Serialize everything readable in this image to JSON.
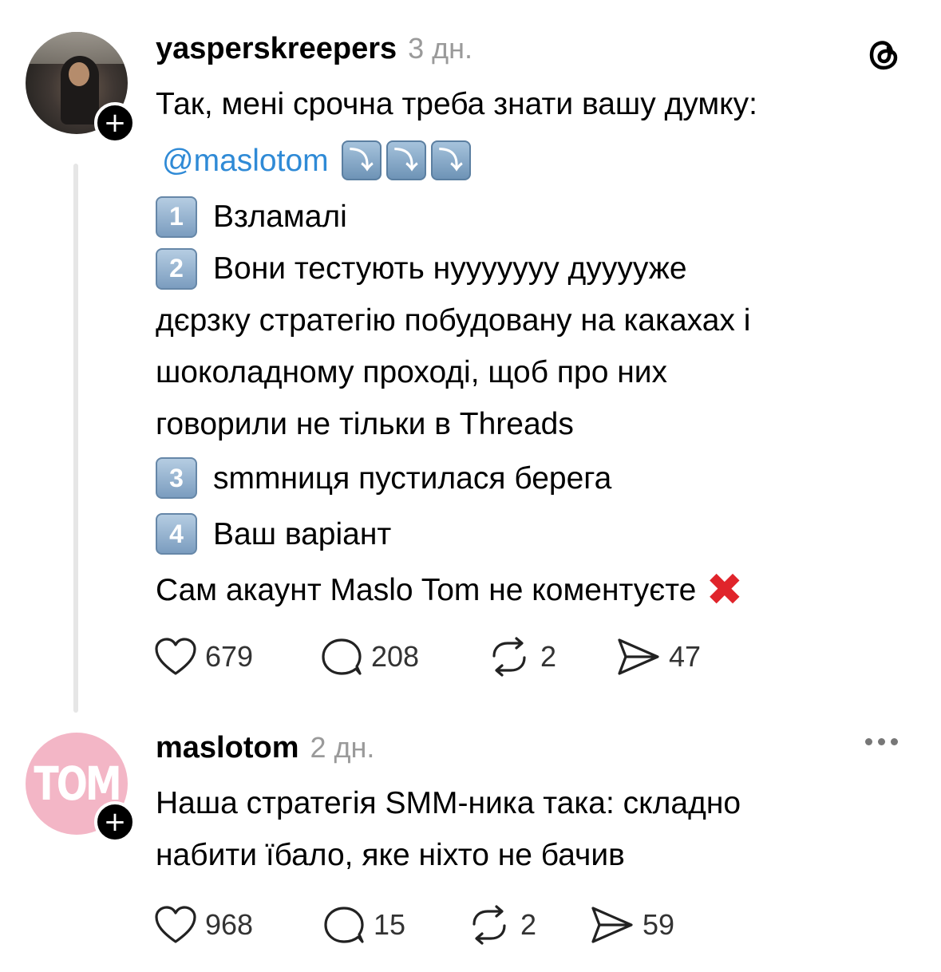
{
  "posts": [
    {
      "username": "yasperskreepers",
      "time": "3 дн.",
      "lines": {
        "intro": "Так, мені срочна треба знати вашу думку:",
        "mention": "@maslotom",
        "arrow_icons": [
          "⤵",
          "⤵",
          "⤵"
        ],
        "option1_num": "1",
        "option1": "Взламалі",
        "option2_num": "2",
        "option2_a": "Вони тестують нууууууу дуууу​же",
        "option2_b": "дєрзку стратегію побудовану на какахах і",
        "option2_c": "шоколадному проході, щоб про них",
        "option2_d": "говорили не тільки в Threads",
        "option3_num": "3",
        "option3": "smmниця пустилася берега",
        "option4_num": "4",
        "option4": "Ваш варіант",
        "closing": "Сам акаунт Maslo Tom не коментуєте",
        "closing_icon": "✖"
      },
      "stats": {
        "likes": "679",
        "replies": "208",
        "reposts": "2",
        "shares": "47"
      }
    },
    {
      "username": "maslotom",
      "time": "2 дн.",
      "avatar_text": "TOM",
      "lines": {
        "l1": "Наша стратегія SMM-ника така: складно",
        "l2": "набити їбало, яке ніхто не бачив"
      },
      "stats": {
        "likes": "968",
        "replies": "15",
        "reposts": "2",
        "shares": "59"
      }
    }
  ],
  "icons": {
    "app": "threads-logo-icon",
    "follow": "+",
    "like": "heart-icon",
    "reply": "comment-icon",
    "repost": "repost-icon",
    "share": "share-icon",
    "more": "more-icon"
  },
  "colors": {
    "mention": "#2f8ad6",
    "timestamp": "#9a9a9a",
    "brand_pink": "#f3b6c6",
    "cross_red": "#e0242b"
  }
}
